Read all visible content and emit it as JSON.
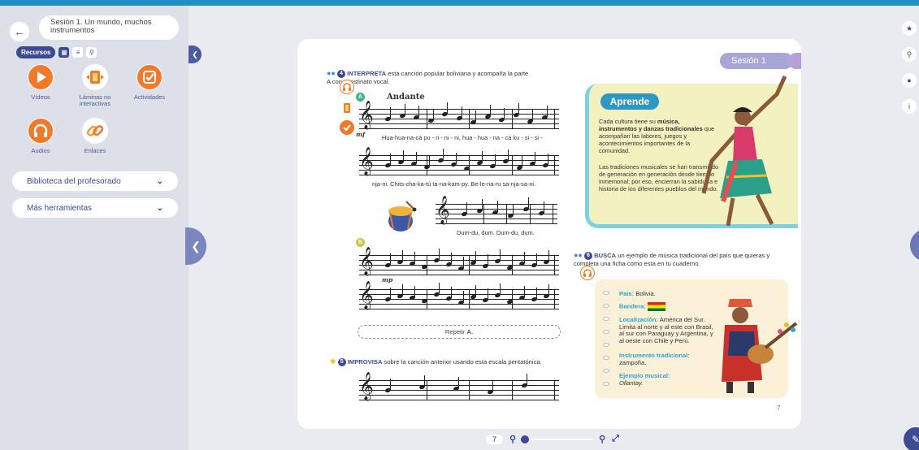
{
  "sidebar": {
    "session_title": "Sesión 1. Un mundo, muchos instrumentos",
    "recursos_label": "Recursos",
    "resources": [
      {
        "label": "Vídeos",
        "icon": "play-icon",
        "color": "#f07a2a"
      },
      {
        "label": "Láminas no interactivas",
        "icon": "layers-icon",
        "color": "#f07a2a"
      },
      {
        "label": "Actividades",
        "icon": "check-icon",
        "color": "#f07a2a"
      },
      {
        "label": "Audios",
        "icon": "headphones-icon",
        "color": "#f07a2a"
      },
      {
        "label": "Enlaces",
        "icon": "link-icon",
        "color": "#f0a040"
      }
    ],
    "accordions": [
      {
        "label": "Biblioteca del profesorado"
      },
      {
        "label": "Más herramientas"
      }
    ]
  },
  "page": {
    "session_tab": "Sesión 1",
    "task4": {
      "num": "4",
      "keyword": "INTERPRETA",
      "text": " esta canción popular boliviana y acompaña la parte A con el ostinato vocal."
    },
    "section_a": "A",
    "tempo": "Andante",
    "dynamic_mf": "mf",
    "lyric1": "Hua-hua-na-cá   pu - ri - ni - ni,   hua - hua - na - cá   ku - si - si -",
    "lyric2": "nja-ni. Chits-cha-ka-tú ta-na-kam-py. Be-le-na-ru sa-nja-sa-ni.",
    "ostinato_lyric": "Dum-du, dum.   Dum-du, dum.",
    "section_b": "B",
    "dynamic_mp": "mp",
    "repetir": "Repetir",
    "repetir_letter": "A.",
    "task5": {
      "num": "5",
      "keyword": "IMPROVISA",
      "text": " sobre la canción anterior usando esta escala pentatónica."
    },
    "aprende": {
      "title": "Aprende",
      "p1_pre": "Cada cultura tiene su ",
      "p1_bold": "música, instrumentos y danzas tradicionales",
      "p1_post": " que acompañan las labores, juegos y acontecimientos importantes de la comunidad.",
      "p2": "Las tradiciones musicales se han transmitido de generación en generación desde tiempo inmemorial; por eso, encierran la sabiduría e historia de los diferentes pueblos del mundo."
    },
    "task6": {
      "num": "6",
      "keyword": "BUSCA",
      "text": " un ejemplo de música tradicional del país que quieras y completa una ficha como esta en tu cuaderno."
    },
    "ficha": {
      "pais_label": "País:",
      "pais": " Bolivia.",
      "bandera_label": "Bandera:",
      "loc_label": "Localización:",
      "loc": " América del Sur. Limita al norte y al este con Brasil, al sur con Paraguay y Argentina, y al oeste con Chile y Perú.",
      "inst_label": "Instrumento tradicional:",
      "inst": "zampoña.",
      "ej_label": "Ejemplo musical:",
      "ej": "Ollantay."
    },
    "page_number": "7"
  },
  "bottom": {
    "page": "7"
  }
}
